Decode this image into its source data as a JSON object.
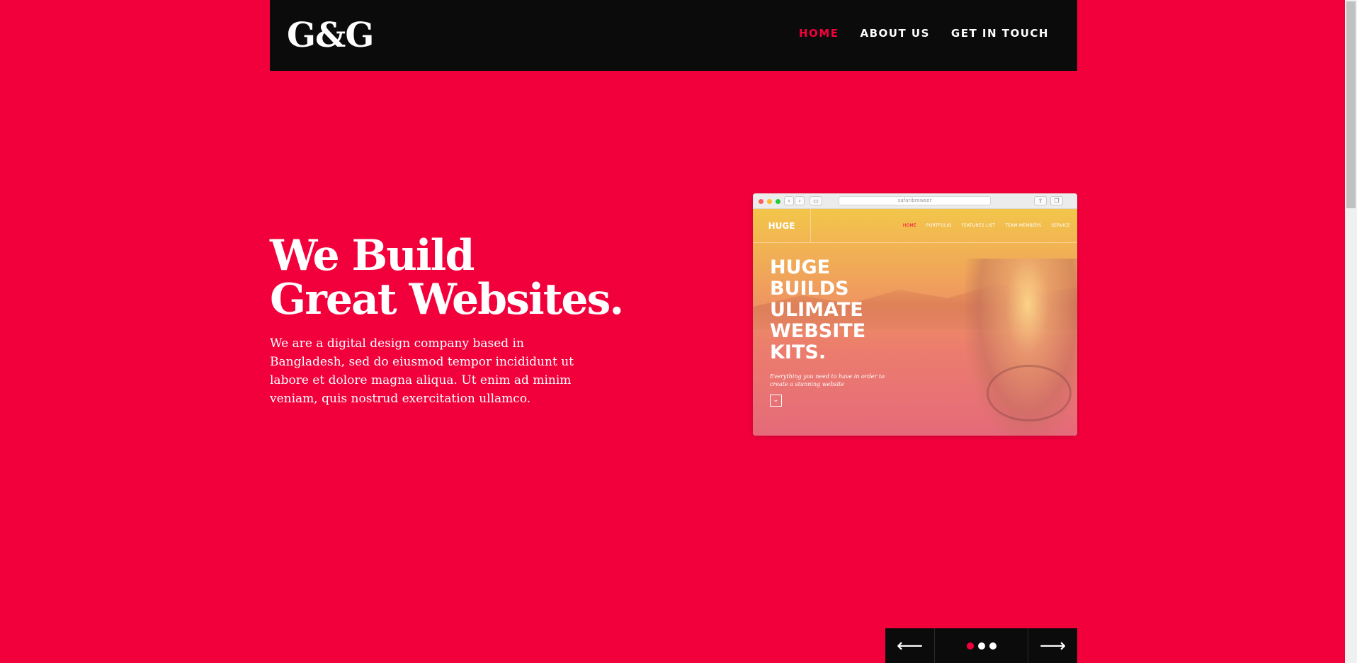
{
  "colors": {
    "accent": "#f2003c",
    "header_bg": "#0b0b0b",
    "text": "#ffffff"
  },
  "header": {
    "logo": "G&G",
    "nav": [
      {
        "label": "HOME",
        "active": true
      },
      {
        "label": "ABOUT US",
        "active": false
      },
      {
        "label": "GET IN TOUCH",
        "active": false
      }
    ]
  },
  "hero": {
    "title_line1": "We Build",
    "title_line2": "Great Websites.",
    "description": "We are a digital design company based in Bangladesh, sed do eiusmod tempor incididunt ut labore et dolore magna aliqua. Ut enim ad minim veniam, quis nostrud exercitation ullamco."
  },
  "mockup": {
    "url": "safaribrowser",
    "brand": "HUGE",
    "nav": [
      {
        "label": "HOME",
        "active": true
      },
      {
        "label": "PORTFOLIO",
        "active": false
      },
      {
        "label": "FEATURES LIST",
        "active": false
      },
      {
        "label": "TEAM MEMBERS",
        "active": false
      },
      {
        "label": "SERVICE",
        "active": false
      }
    ],
    "headline": [
      "HUGE",
      "BUILDS",
      "ULIMATE",
      "WEBSITE",
      "KITS."
    ],
    "subtext": "Everything you need to have in order to create a stunning website"
  },
  "slider": {
    "prev_icon": "arrow-left-icon",
    "next_icon": "arrow-right-icon",
    "prev_glyph": "⟵",
    "next_glyph": "⟶",
    "pages": 3,
    "active_page": 1
  }
}
